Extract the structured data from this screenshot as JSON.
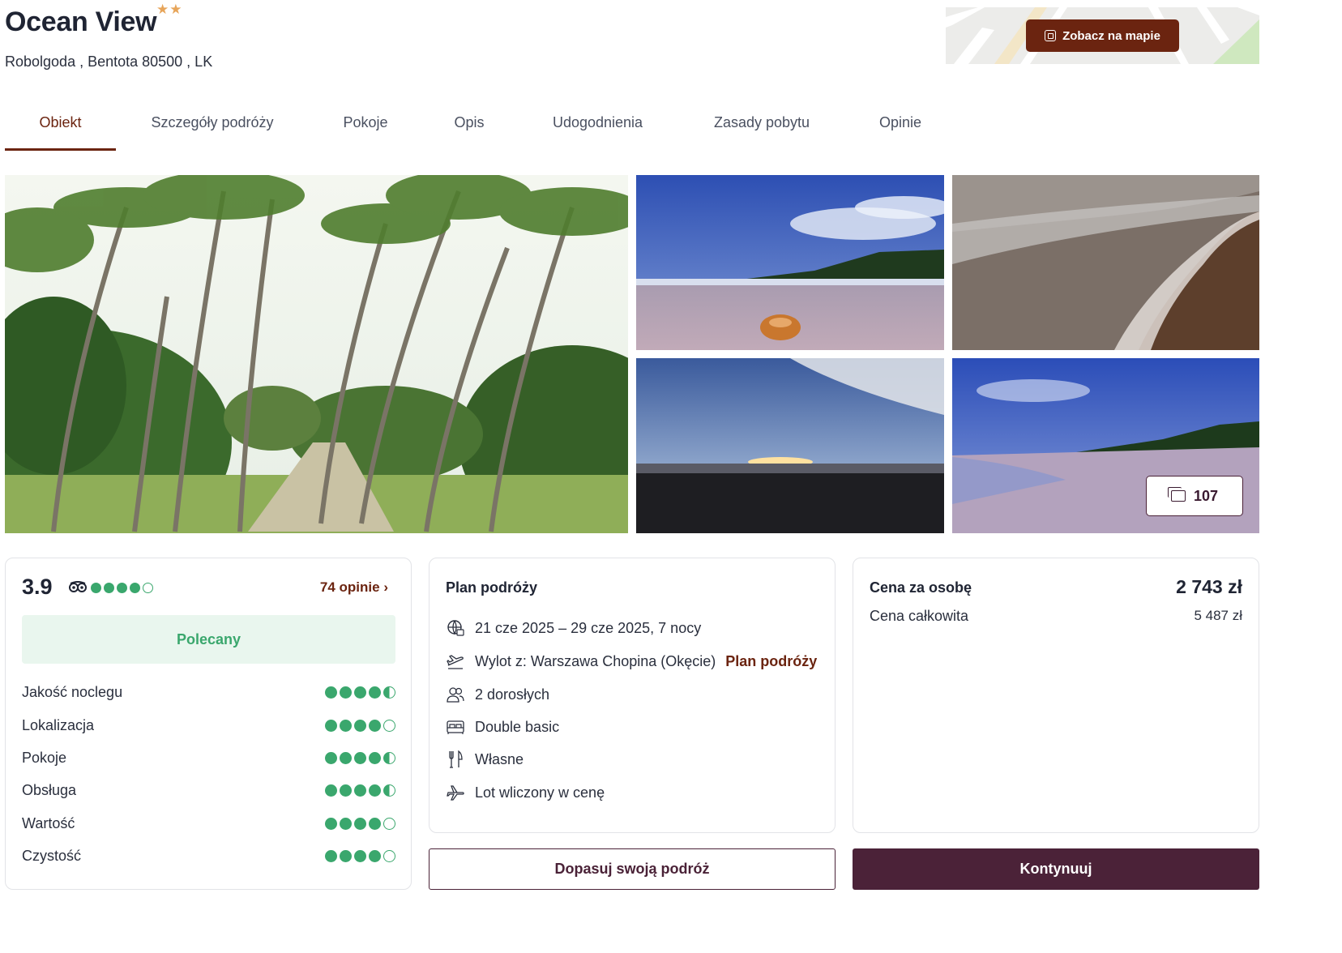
{
  "hotel": {
    "name": "Ocean View",
    "stars": "★★",
    "star_rating": 2,
    "address": "Robolgoda , Bentota 80500 , LK"
  },
  "map": {
    "button_label": "Zobacz na mapie"
  },
  "tabs": [
    {
      "label": "Obiekt",
      "active": true
    },
    {
      "label": "Szczegóły podróży",
      "active": false
    },
    {
      "label": "Pokoje",
      "active": false
    },
    {
      "label": "Opis",
      "active": false
    },
    {
      "label": "Udogodnienia",
      "active": false
    },
    {
      "label": "Zasady pobytu",
      "active": false
    },
    {
      "label": "Opinie",
      "active": false
    }
  ],
  "gallery": {
    "photo_count": "107",
    "photos": [
      "palm-grove-photo",
      "beach-coconut-photo",
      "shoreline-waves-photo",
      "sunset-photo",
      "beach-coast-photo"
    ]
  },
  "rating": {
    "score": "3.9",
    "score_dots": 4,
    "reviews_link": "74 opinie",
    "badge": "Polecany",
    "categories": [
      {
        "label": "Jakość noclegu",
        "value": 4.5
      },
      {
        "label": "Lokalizacja",
        "value": 4
      },
      {
        "label": "Pokoje",
        "value": 4.5
      },
      {
        "label": "Obsługa",
        "value": 4.5
      },
      {
        "label": "Wartość",
        "value": 4
      },
      {
        "label": "Czystość",
        "value": 4
      }
    ]
  },
  "plan": {
    "title": "Plan podróży",
    "dates": "21 cze 2025 – 29 cze 2025, 7 nocy",
    "departure": "Wylot z: Warszawa Chopina (Okęcie)",
    "departure_link": "Plan podróży",
    "guests": "2 dorosłych",
    "room": "Double basic",
    "board": "Własne",
    "flight": "Lot wliczony w cenę"
  },
  "price": {
    "per_person_label": "Cena za osobę",
    "per_person_value": "2 743 zł",
    "total_label": "Cena całkowita",
    "total_value": "5 487 zł"
  },
  "actions": {
    "customize": "Dopasuj swoją podróż",
    "continue": "Kontynuuj"
  },
  "colors": {
    "brand": "#6b2410",
    "primary_button": "#4b2238",
    "rating_green": "#3aa76d",
    "star": "#e7a55a"
  }
}
